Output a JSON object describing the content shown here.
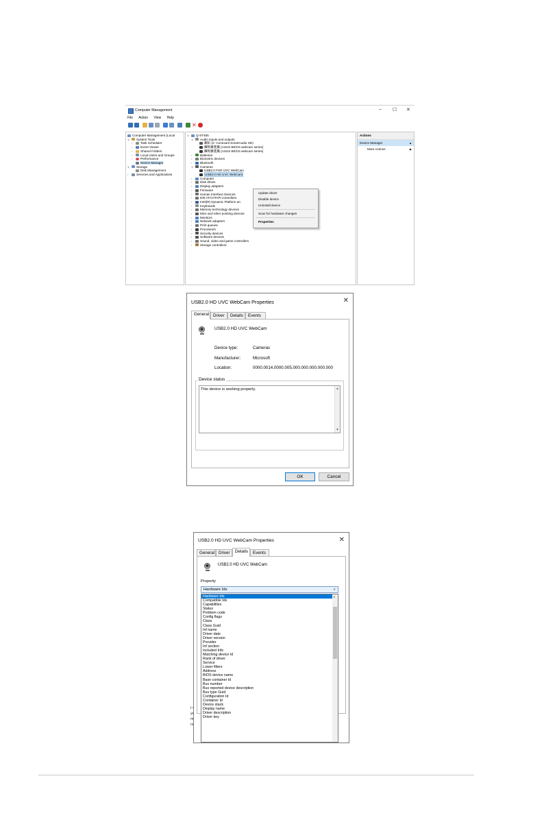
{
  "cm": {
    "title": "Computer Management",
    "controls": {
      "min": "–",
      "max": "☐",
      "close": "✕"
    },
    "menu": [
      "File",
      "Action",
      "View",
      "Help"
    ],
    "left_tree": [
      "Computer Management (Local",
      "System Tools",
      "Task Scheduler",
      "Event Viewer",
      "Shared Folders",
      "Local Users and Groups",
      "Performance",
      "Device Manager",
      "Storage",
      "Disk Management",
      "Services and Applications"
    ],
    "device_tree": [
      "Q-ST465",
      "Audio inputs and outputs",
      "喇叭 (2- Conexant SmartAudio HD)",
      "陣列麥克風 (ASUS BE/C6 webcam series)",
      "陣列麥克風 (ASUS BE/C6 webcam series)",
      "Batteries",
      "Biometric devices",
      "Bluetooth",
      "Cameras",
      "USB2.0 FHD UVC WebCam",
      "USB2.0 HD UVC WebCam",
      "Computer",
      "Disk drives",
      "Display adapters",
      "Firmware",
      "Human Interface Devices",
      "IDE ATA/ATAPI controllers",
      "Intel(R) Dynamic Platform an",
      "Keyboards",
      "Memory technology devices",
      "Mice and other pointing devices",
      "Monitors",
      "Network adapters",
      "Print queues",
      "Processors",
      "Security devices",
      "Software devices",
      "Sound, video and game controllers",
      "Storage controllers"
    ],
    "context_menu": [
      "Update driver",
      "Disable device",
      "Uninstall device",
      "Scan for hardware changes",
      "Properties"
    ],
    "actions": {
      "header": "Actions",
      "section": "Device Manager",
      "more": "More Actions"
    }
  },
  "dlg1": {
    "title": "USB2.0 HD UVC WebCam Properties",
    "tabs": [
      "General",
      "Driver",
      "Details",
      "Events"
    ],
    "device_name": "USB2.0 HD UVC WebCam",
    "fields": [
      {
        "label": "Device type:",
        "value": "Cameras"
      },
      {
        "label": "Manufacturer:",
        "value": "Microsoft"
      },
      {
        "label": "Location:",
        "value": "0000.0014.0000.005.000.000.000.000.000"
      }
    ],
    "status_legend": "Device status",
    "status_text": "This device is working properly.",
    "ok": "OK",
    "cancel": "Cancel"
  },
  "dlg2": {
    "title": "USB2.0 HD UVC WebCam Properties",
    "tabs": [
      "General",
      "Driver",
      "Details",
      "Events"
    ],
    "device_name": "USB2.0 HD UVC WebCam",
    "property_label": "Property",
    "selected": "Hardware Ids",
    "options": [
      "Hardware Ids",
      "Compatible Ids",
      "Capabilities",
      "Status",
      "Problem code",
      "Config flags",
      "Class",
      "Class Guid",
      "Inf name",
      "Driver date",
      "Driver version",
      "Provider",
      "Inf section",
      "Included Infs",
      "Matching device Id",
      "Rank of driver",
      "Service",
      "Lower filters",
      "Address",
      "BIOS device name",
      "Base container Id",
      "Bus number",
      "Bus reported device description",
      "Bus type Guid",
      "Configuration Id",
      "Container Id",
      "Device stack",
      "Display name",
      "Driver description",
      "Driver key"
    ],
    "behind": [
      "t vie",
      "ye co",
      "m de",
      "rsal t"
    ]
  },
  "colors": {
    "accent": "#0078d7",
    "selection": "#cce4f7"
  }
}
